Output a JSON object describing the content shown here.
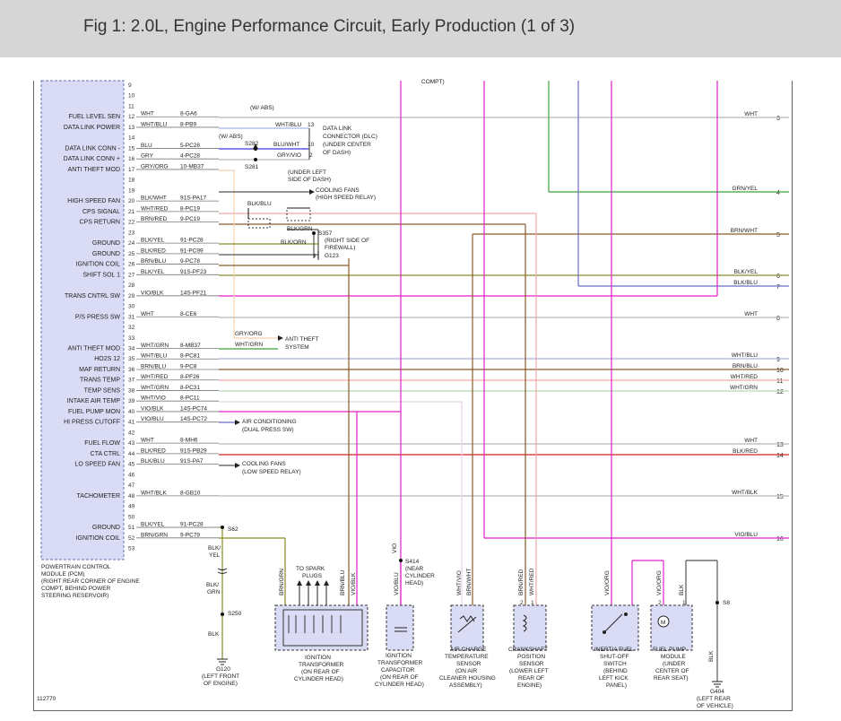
{
  "header": {
    "title": "Fig 1: 2.0L, Engine Performance Circuit, Early Production (1 of 3)"
  },
  "figure_id": "112770",
  "pcm": {
    "box_label": [
      "POWERTRAIN CONTROL",
      "MODULE (PCM)",
      "(RIGHT REAR CORNER OF ENGINE",
      "COMPT, BEHIND POWER",
      "STEERING RESERVOIR)"
    ],
    "pins": [
      "9",
      "10",
      "11",
      "12",
      "13",
      "14",
      "15",
      "16",
      "17",
      "18",
      "19",
      "20",
      "21",
      "22",
      "23",
      "24",
      "25",
      "26",
      "27",
      "28",
      "29",
      "30",
      "31",
      "32",
      "33",
      "34",
      "35",
      "36",
      "37",
      "38",
      "39",
      "40",
      "41",
      "42",
      "43",
      "44",
      "45",
      "46",
      "47",
      "48",
      "49",
      "50",
      "51",
      "52",
      "53"
    ],
    "labels": [
      {
        "pin": "12",
        "text": "FUEL LEVEL SEN"
      },
      {
        "pin": "13",
        "text": "DATA LINK POWER"
      },
      {
        "pin": "15",
        "text": "DATA LINK CONN -"
      },
      {
        "pin": "16",
        "text": "DATA LINK CONN +"
      },
      {
        "pin": "17",
        "text": "ANTI THEFT MOD"
      },
      {
        "pin": "20",
        "text": "HIGH SPEED FAN"
      },
      {
        "pin": "21",
        "text": "CPS SIGNAL"
      },
      {
        "pin": "22",
        "text": "CPS RETURN"
      },
      {
        "pin": "24",
        "text": "GROUND"
      },
      {
        "pin": "25",
        "text": "GROUND"
      },
      {
        "pin": "26",
        "text": "IGNITION COIL"
      },
      {
        "pin": "27",
        "text": "SHIFT SOL 1"
      },
      {
        "pin": "29",
        "text": "TRANS CNTRL SW"
      },
      {
        "pin": "31",
        "text": "P/S PRESS SW"
      },
      {
        "pin": "34",
        "text": "ANTI THEFT MOD"
      },
      {
        "pin": "35",
        "text": "HO2S 12"
      },
      {
        "pin": "36",
        "text": "MAF RETURN"
      },
      {
        "pin": "37",
        "text": "TRANS TEMP"
      },
      {
        "pin": "38",
        "text": "TEMP SENS"
      },
      {
        "pin": "39",
        "text": "INTAKE AIR TEMP"
      },
      {
        "pin": "40",
        "text": "FUEL PUMP MON"
      },
      {
        "pin": "41",
        "text": "HI PRESS CUTOFF"
      },
      {
        "pin": "43",
        "text": "FUEL FLOW"
      },
      {
        "pin": "44",
        "text": "CTA CTRL"
      },
      {
        "pin": "45",
        "text": "LO SPEED FAN"
      },
      {
        "pin": "48",
        "text": "TACHOMETER"
      },
      {
        "pin": "51",
        "text": "GROUND"
      },
      {
        "pin": "52",
        "text": "IGNITION COIL"
      }
    ]
  },
  "wires": [
    {
      "pin": "12",
      "color": "WHT",
      "circuit": "8-GA6"
    },
    {
      "pin": "13",
      "color": "WHT/BLU",
      "circuit": "8-PB9"
    },
    {
      "pin": "15",
      "color": "BLU",
      "circuit": "5-PC28"
    },
    {
      "pin": "16",
      "color": "GRY",
      "circuit": "4-PC28"
    },
    {
      "pin": "17",
      "color": "GRY/ORG",
      "circuit": "10-MB37"
    },
    {
      "pin": "20",
      "color": "BLK/WHT",
      "circuit": "91S-PA17"
    },
    {
      "pin": "21",
      "color": "WHT/RED",
      "circuit": "8-PC19"
    },
    {
      "pin": "22",
      "color": "BRN/RED",
      "circuit": "9-PC19"
    },
    {
      "pin": "24",
      "color": "BLK/YEL",
      "circuit": "91-PC28"
    },
    {
      "pin": "25",
      "color": "BLK/RED",
      "circuit": "91-PC99"
    },
    {
      "pin": "26",
      "color": "BRN/BLU",
      "circuit": "9-PC78"
    },
    {
      "pin": "27",
      "color": "BLK/YEL",
      "circuit": "91S-PF23"
    },
    {
      "pin": "29",
      "color": "VIO/BLK",
      "circuit": "14S-PF21"
    },
    {
      "pin": "31",
      "color": "WHT",
      "circuit": "8-CE6"
    },
    {
      "pin": "34",
      "color": "WHT/GRN",
      "circuit": "8-MB37"
    },
    {
      "pin": "35",
      "color": "WHT/BLU",
      "circuit": "8-PC81"
    },
    {
      "pin": "36",
      "color": "BRN/BLU",
      "circuit": "9-PC8"
    },
    {
      "pin": "37",
      "color": "WHT/RED",
      "circuit": "8-PF26"
    },
    {
      "pin": "38",
      "color": "WHT/GRN",
      "circuit": "8-PC31"
    },
    {
      "pin": "39",
      "color": "WHT/VIO",
      "circuit": "8-PC11"
    },
    {
      "pin": "40",
      "color": "VIO/BLK",
      "circuit": "14S-PC74"
    },
    {
      "pin": "41",
      "color": "VIO/BLU",
      "circuit": "14S-PC72"
    },
    {
      "pin": "43",
      "color": "WHT",
      "circuit": "8-MH6"
    },
    {
      "pin": "44",
      "color": "BLK/RED",
      "circuit": "91S-PB29"
    },
    {
      "pin": "45",
      "color": "BLK/BLU",
      "circuit": "91S-PA7"
    },
    {
      "pin": "48",
      "color": "WHT/BLK",
      "circuit": "8-GB10"
    },
    {
      "pin": "51",
      "color": "BLK/YEL",
      "circuit": "91-PC28"
    },
    {
      "pin": "52",
      "color": "BRN/GRN",
      "circuit": "9-PC79"
    }
  ],
  "right_edge": [
    {
      "ref": "3",
      "color": "WHT"
    },
    {
      "ref": "4",
      "color": "GRN/YEL"
    },
    {
      "ref": "5",
      "color": "BRN/WHT"
    },
    {
      "ref": "6",
      "color": "BLK/YEL"
    },
    {
      "ref": "7",
      "color": "BLK/BLU"
    },
    {
      "ref": "8",
      "color": "WHT"
    },
    {
      "ref": "9",
      "color": "WHT/BLU"
    },
    {
      "ref": "10",
      "color": "BRN/BLU"
    },
    {
      "ref": "11",
      "color": "WHT/RED"
    },
    {
      "ref": "12",
      "color": "WHT/GRN"
    },
    {
      "ref": "13",
      "color": "WHT"
    },
    {
      "ref": "14",
      "color": "BLK/RED"
    },
    {
      "ref": "15",
      "color": "WHT/BLK"
    },
    {
      "ref": "16",
      "color": "VIO/BLU"
    }
  ],
  "dlc": {
    "note": "(W/ ABS)",
    "wires": [
      {
        "color": "WHT/BLU",
        "pin": "13"
      },
      {
        "color": "BLU/WHT",
        "pin": "10"
      },
      {
        "color": "GRY/VIO",
        "pin": "2"
      }
    ],
    "label": [
      "DATA LINK",
      "CONNECTOR (DLC)",
      "(UNDER CENTER",
      "OF DASH)"
    ],
    "s282_note": "(W/ ABS)",
    "s282": "S282",
    "s281": "S281",
    "splice_location": [
      "(UNDER LEFT",
      "SIDE OF DASH)"
    ]
  },
  "cooling_fans_high": [
    "COOLING FANS",
    "(HIGH SPEED RELAY)"
  ],
  "cps": {
    "blk_blu": "BLK/BLU",
    "blk_grn": "BLK/GRN",
    "s357": "S357",
    "blk_orn": "BLK/ORN",
    "location": [
      "(RIGHT SIDE OF",
      "FIREWALL)"
    ],
    "g123": "G123"
  },
  "anti_theft": {
    "gry_org": "GRY/ORG",
    "wht_grn": "WHT/GRN",
    "label": [
      "ANTI THEFT",
      "SYSTEM"
    ]
  },
  "ac": [
    "AIR CONDITIONING",
    "(DUAL PRESS SW)"
  ],
  "cooling_fans_low": [
    "COOLING FANS",
    "(LOW SPEED RELAY)"
  ],
  "ground_s62": {
    "s62": "S62",
    "blk_yel": [
      "BLK/",
      "YEL"
    ],
    "blk_grn": [
      "BLK/",
      "GRN"
    ],
    "s250": "S250",
    "blk": "BLK",
    "g120": [
      "G120",
      "(LEFT FRONT",
      "OF ENGINE)"
    ]
  },
  "top_cut_text": "COMPT)",
  "s414": {
    "vio": "VIO",
    "label": [
      "S414",
      "(NEAR",
      "CYLINDER",
      "HEAD)"
    ]
  },
  "components": {
    "ignition_transformer": {
      "wires": [
        "BRN/GRN",
        "BRN/BLU",
        "VIO/BLK"
      ],
      "plugs_label": [
        "TO SPARK",
        "PLUGS"
      ],
      "label": [
        "IGNITION",
        "TRANSFORMER",
        "(ON REAR OF",
        "CYLINDER HEAD)"
      ]
    },
    "capacitor": {
      "wire": "VIO/BLU",
      "label": [
        "IGNITION",
        "TRANSFORMER",
        "CAPACITOR",
        "(ON REAR OF",
        "CYLINDER HEAD)"
      ]
    },
    "air_charge_temp": {
      "wires": [
        "WHT/VIO",
        "BRN/WHT"
      ],
      "label": [
        "AIR CHARGE",
        "TEMPERATURE",
        "SENSOR",
        "(ON AIR",
        "CLEANER HOUSING",
        "ASSEMBLY)"
      ]
    },
    "crankshaft": {
      "wires": [
        "BRN/RED",
        "WHT/RED"
      ],
      "pins": [
        "2",
        "1"
      ],
      "label": [
        "CRANKSHAFT",
        "POSITION",
        "SENSOR",
        "(LOWER LEFT",
        "REAR OF",
        "ENGINE)"
      ]
    },
    "inertia": {
      "wire": "VIO/ORG",
      "label": [
        "INERTIA FUEL",
        "SHUT-OFF",
        "SWITCH",
        "(BEHIND",
        "LEFT KICK",
        "PANEL)"
      ]
    },
    "fuel_pump": {
      "wires": [
        "VIO/ORG",
        "BLK"
      ],
      "pins": [
        "2",
        "1"
      ],
      "motor": "M",
      "label": [
        "FUEL PUMP",
        "MODULE",
        "(UNDER",
        "CENTER OF",
        "REAR SEAT)"
      ]
    },
    "s8_g404": {
      "s8": "S8",
      "blk": "BLK",
      "label": [
        "G404",
        "(LEFT REAR",
        "OF VEHICLE)"
      ]
    }
  },
  "colors": {
    "header_bg": "#d6d6d6",
    "pcm_fill": "#d9dcf4",
    "magenta": "#e020c8",
    "green": "#3aa23a",
    "purple": "#6a6ac8",
    "brown": "#8a5a2a",
    "olive": "#8a8a2a",
    "pink": "#f0a8a8",
    "gray": "#b8b8b8",
    "red": "#d02020",
    "lightblue": "#a8b4e8"
  }
}
